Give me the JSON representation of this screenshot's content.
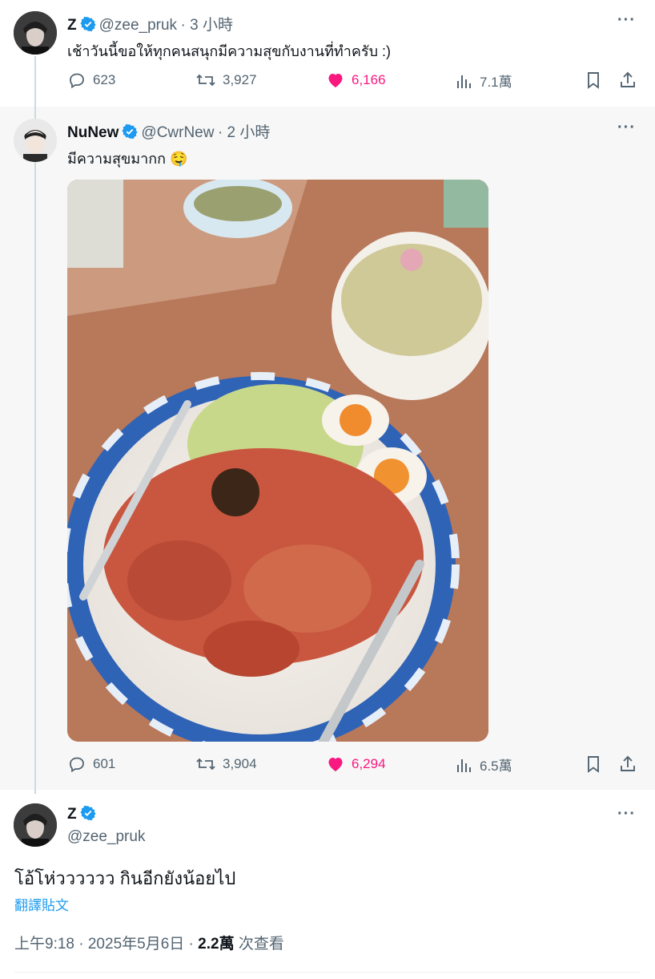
{
  "tweet1": {
    "name": "Z",
    "handle": "@zee_pruk",
    "time": "· 3 小時",
    "text": "เช้าวันนี้ขอให้ทุกคนสนุกมีความสุขกับงานที่ทำครับ :)",
    "replies": "623",
    "retweets": "3,927",
    "likes": "6,166",
    "views": "7.1萬"
  },
  "tweet2": {
    "name": "NuNew",
    "handle": "@CwrNew",
    "time": "· 2 小時",
    "text": "มีความสุขมากก 🤤",
    "replies": "601",
    "retweets": "3,904",
    "likes": "6,294",
    "views": "6.5萬"
  },
  "tweet3": {
    "name": "Z",
    "handle": "@zee_pruk",
    "text": "โอ้โห่วววววว กินอีกยังน้อยไป",
    "translate_label": "翻譯貼文",
    "time": "上午9:18 · 2025年5月6日 · ",
    "views_count": "2.2萬",
    "views_label": " 次查看"
  },
  "colors": {
    "verified": "#1d9bf0",
    "like": "#f91880",
    "muted": "#536471"
  },
  "icons": [
    "more-icon",
    "verified-icon",
    "reply-icon",
    "retweet-icon",
    "heart-icon",
    "views-icon",
    "bookmark-icon",
    "share-icon"
  ]
}
